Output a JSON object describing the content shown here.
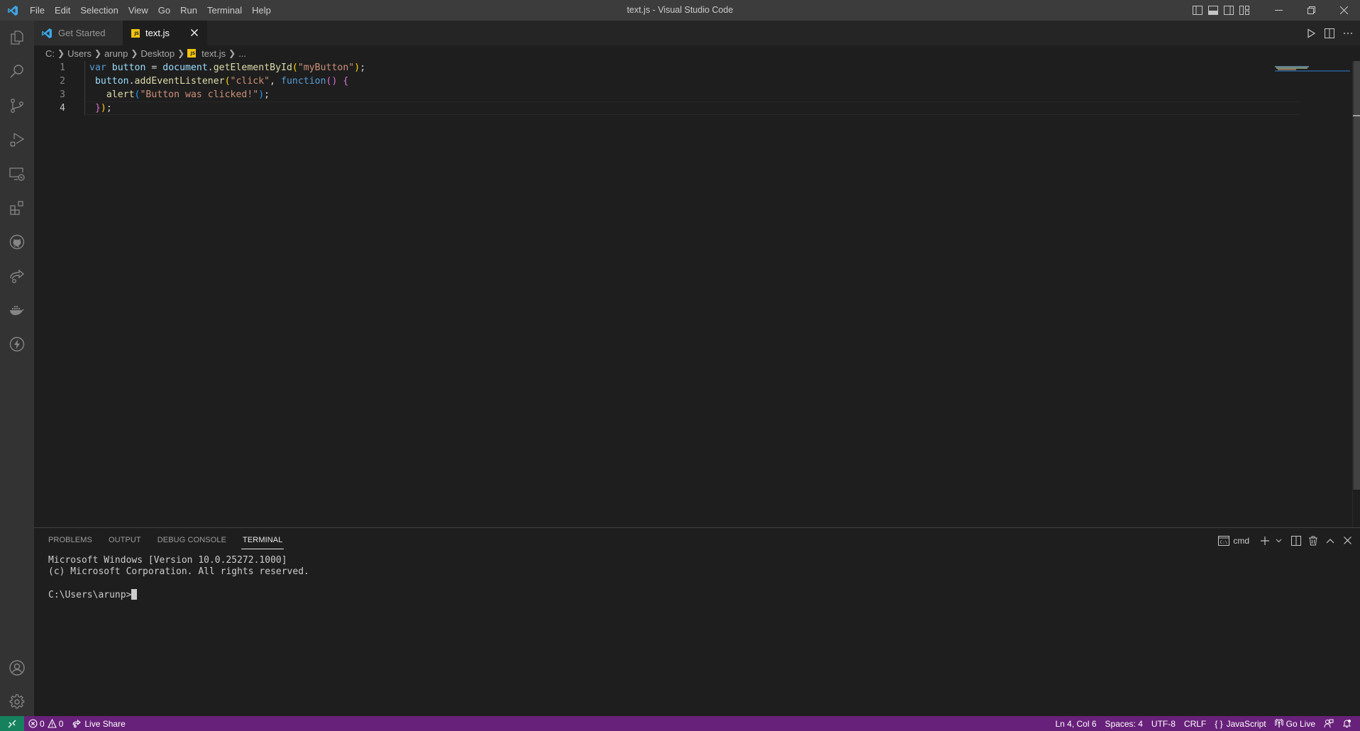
{
  "window": {
    "title": "text.js - Visual Studio Code"
  },
  "menu": [
    "File",
    "Edit",
    "Selection",
    "View",
    "Go",
    "Run",
    "Terminal",
    "Help"
  ],
  "activity_bar": {
    "top": [
      "explorer-icon",
      "search-icon",
      "source-control-icon",
      "run-debug-icon",
      "remote-explorer-icon",
      "extensions-icon",
      "github-icon",
      "live-share-icon",
      "docker-icon",
      "thunder-client-icon"
    ],
    "bottom": [
      "accounts-icon",
      "manage-gear-icon"
    ]
  },
  "tabs": [
    {
      "label": "Get Started",
      "icon": "vscode-logo-icon",
      "active": false
    },
    {
      "label": "text.js",
      "icon": "js-file-icon",
      "active": true
    }
  ],
  "breadcrumb": {
    "parts": [
      "C:",
      "Users",
      "arunp",
      "Desktop"
    ],
    "file": "text.js",
    "more": "..."
  },
  "editor": {
    "language_badge": "JS",
    "lines": [
      {
        "no": "1",
        "text": "var button = document.getElementById(\"myButton\");"
      },
      {
        "no": "2",
        "text": " button.addEventListener(\"click\", function() {"
      },
      {
        "no": "3",
        "text": "   alert(\"Button was clicked!\");"
      },
      {
        "no": "4",
        "text": " });"
      }
    ],
    "current_line": 4
  },
  "panel": {
    "tabs": [
      "PROBLEMS",
      "OUTPUT",
      "DEBUG CONSOLE",
      "TERMINAL"
    ],
    "active_tab": "TERMINAL",
    "terminal_name": "cmd",
    "terminal_lines": [
      "Microsoft Windows [Version 10.0.25272.1000]",
      "(c) Microsoft Corporation. All rights reserved.",
      "",
      "C:\\Users\\arunp>"
    ]
  },
  "status_bar": {
    "errors": "0",
    "warnings": "0",
    "live_share": "Live Share",
    "position": "Ln 4, Col 6",
    "spaces": "Spaces: 4",
    "encoding": "UTF-8",
    "eol": "CRLF",
    "language": "JavaScript",
    "go_live": "Go Live",
    "colors": {
      "background": "#68217a",
      "remote": "#16825d"
    }
  }
}
